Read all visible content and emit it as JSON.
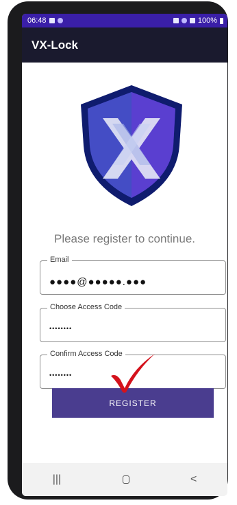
{
  "status_bar": {
    "time": "06:48",
    "battery": "100%"
  },
  "app_bar": {
    "title": "VX-Lock"
  },
  "form": {
    "prompt": "Please register to continue.",
    "email": {
      "label": "Email",
      "value": "●●●●@●●●●●.●●●"
    },
    "access_code": {
      "label": "Choose Access Code",
      "value": "••••••••"
    },
    "confirm_code": {
      "label": "Confirm Access Code",
      "value": "••••••••"
    },
    "register_label": "REGISTER"
  },
  "nav_bar": {
    "recents": "|||",
    "back": "<"
  },
  "colors": {
    "status_bar": "#3a1fa8",
    "app_bar": "#1a1a2e",
    "button": "#4a3d8f",
    "check": "#d4121c",
    "shield": "#3b2cb5"
  }
}
